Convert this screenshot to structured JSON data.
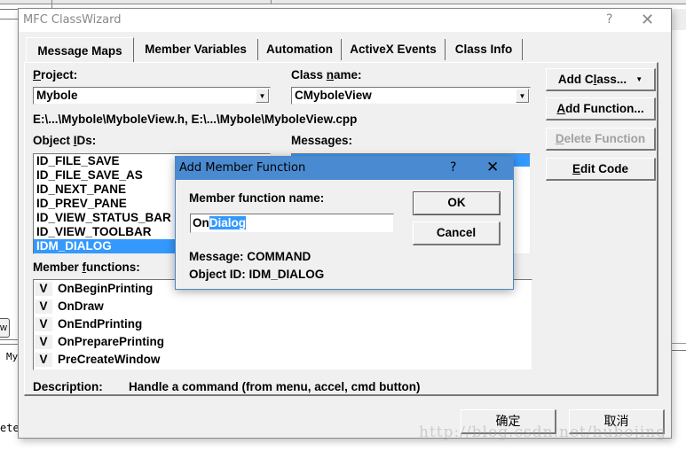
{
  "background": {
    "left_button_fragment": "w",
    "left_text_1": "My",
    "left_text_2": "ete"
  },
  "wizard": {
    "title": "MFC ClassWizard",
    "help_glyph": "?",
    "close_glyph": "✕",
    "tabs": [
      {
        "label": "Message Maps",
        "active": true
      },
      {
        "label": "Member Variables",
        "active": false
      },
      {
        "label": "Automation",
        "active": false
      },
      {
        "label": "ActiveX Events",
        "active": false
      },
      {
        "label": "Class Info",
        "active": false
      }
    ],
    "project": {
      "label_mnemonic": "P",
      "label_rest": "roject:",
      "value": "Mybole"
    },
    "class_name": {
      "label_pre": "Class ",
      "label_mnemonic": "n",
      "label_rest": "ame:",
      "value": "CMyboleView"
    },
    "files_path": "E:\\...\\Mybole\\MyboleView.h, E:\\...\\Mybole\\MyboleView.cpp",
    "object_ids": {
      "label_pre": "Object ",
      "label_mnemonic": "I",
      "label_rest": "Ds:",
      "items": [
        {
          "label": "ID_FILE_SAVE",
          "selected": false
        },
        {
          "label": "ID_FILE_SAVE_AS",
          "selected": false
        },
        {
          "label": "ID_NEXT_PANE",
          "selected": false
        },
        {
          "label": "ID_PREV_PANE",
          "selected": false
        },
        {
          "label": "ID_VIEW_STATUS_BAR",
          "selected": false
        },
        {
          "label": "ID_VIEW_TOOLBAR",
          "selected": false
        },
        {
          "label": "IDM_DIALOG",
          "selected": true
        }
      ]
    },
    "messages": {
      "label_pre": "Messa",
      "label_mnemonic": "g",
      "label_rest": "es:"
    },
    "buttons": {
      "add_class_pre": "Add C",
      "add_class_mnemonic": "l",
      "add_class_rest": "ass...",
      "add_class_arrow": "▼",
      "add_function_mnemonic": "A",
      "add_function_rest": "dd Function...",
      "delete_function_mnemonic": "D",
      "delete_function_rest": "elete Function",
      "edit_code_mnemonic": "E",
      "edit_code_rest": "dit Code",
      "ok": "确定",
      "cancel": "取消"
    },
    "member_functions": {
      "label_pre": "Member ",
      "label_mnemonic": "f",
      "label_rest": "unctions:",
      "items": [
        {
          "flag": "V",
          "name": "OnBeginPrinting"
        },
        {
          "flag": "V",
          "name": "OnDraw"
        },
        {
          "flag": "V",
          "name": "OnEndPrinting"
        },
        {
          "flag": "V",
          "name": "OnPreparePrinting"
        },
        {
          "flag": "V",
          "name": "PreCreateWindow"
        }
      ]
    },
    "description": {
      "label": "Description:",
      "value": "Handle a command (from menu, accel, cmd button)"
    }
  },
  "add_member_function": {
    "title": "Add Member Function",
    "help_glyph": "?",
    "close_glyph": "✕",
    "name_label": "Member function name:",
    "name_value_prefix": "On",
    "name_value_selected": "Dialog",
    "message_line": "Message: COMMAND",
    "object_id_line": "Object ID: IDM_DIALOG",
    "ok_label": "OK",
    "cancel_label": "Cancel"
  },
  "watermark": "http://blog.csdn.net/hubojing"
}
